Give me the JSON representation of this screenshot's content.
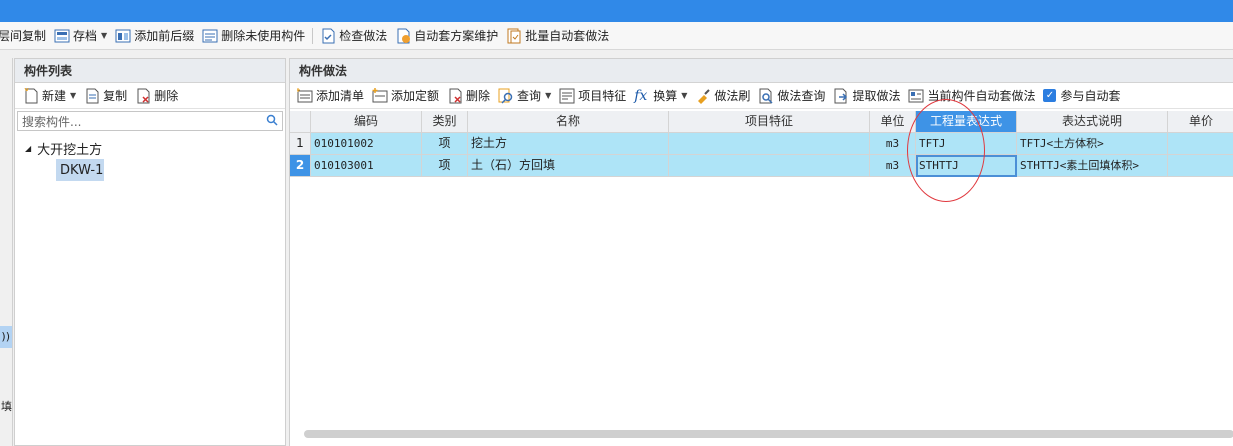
{
  "toolbar": {
    "items": [
      {
        "label": "层间复制",
        "icon": "copy-layers-icon"
      },
      {
        "label": "存档",
        "icon": "archive-icon",
        "dropdown": true
      },
      {
        "label": "添加前后缀",
        "icon": "add-prefix-icon"
      },
      {
        "label": "删除未使用构件",
        "icon": "delete-unused-icon"
      },
      {
        "label": "检查做法",
        "icon": "check-method-icon"
      },
      {
        "label": "自动套方案维护",
        "icon": "auto-scheme-icon"
      },
      {
        "label": "批量自动套做法",
        "icon": "batch-auto-icon"
      }
    ]
  },
  "left_stub": {
    "selected_text": "))",
    "bottom_text": "填"
  },
  "component_list": {
    "title": "构件列表",
    "toolbar": {
      "new_label": "新建",
      "copy_label": "复制",
      "delete_label": "删除"
    },
    "search_placeholder": "搜索构件...",
    "tree": {
      "parent": "大开挖土方",
      "child": "DKW-1"
    }
  },
  "method_panel": {
    "title": "构件做法",
    "toolbar": {
      "add_list": "添加清单",
      "add_quota": "添加定额",
      "delete": "删除",
      "query": "查询",
      "project_feature": "项目特征",
      "convert": "换算",
      "method_brush": "做法刷",
      "method_query": "做法查询",
      "extract_method": "提取做法",
      "current_auto": "当前构件自动套做法",
      "participate_auto": "参与自动套"
    },
    "columns": [
      "编码",
      "类别",
      "名称",
      "项目特征",
      "单位",
      "工程量表达式",
      "表达式说明",
      "单价"
    ],
    "rows": [
      {
        "num": "1",
        "code": "010101002",
        "category": "项",
        "name": "挖土方",
        "feature": "",
        "unit": "m3",
        "expr": "TFTJ",
        "desc": "TFTJ<土方体积>"
      },
      {
        "num": "2",
        "code": "010103001",
        "category": "项",
        "name": "土（石）方回填",
        "feature": "",
        "unit": "m3",
        "expr": "STHTTJ",
        "desc": "STHTTJ<素土回填体积>"
      }
    ]
  }
}
